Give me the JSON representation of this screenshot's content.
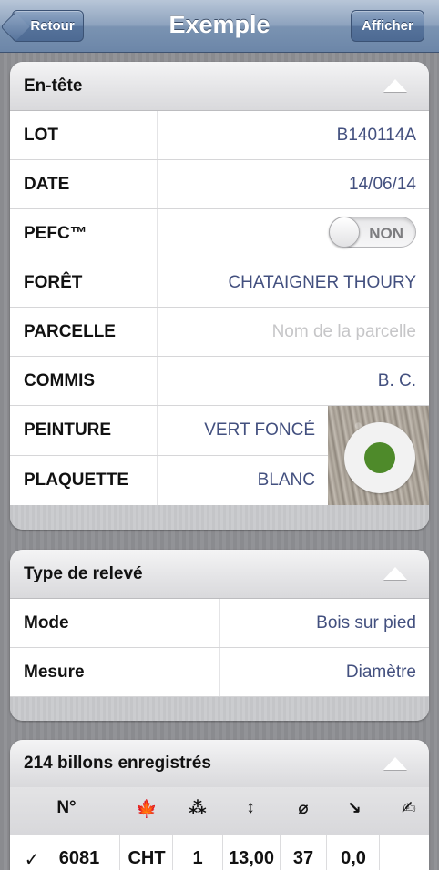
{
  "nav": {
    "title": "Exemple",
    "back_label": "Retour",
    "show_label": "Afficher"
  },
  "header_section": {
    "title": "En-tête",
    "rows": [
      {
        "label": "LOT",
        "value": "B140114A"
      },
      {
        "label": "DATE",
        "value": "14/06/14"
      },
      {
        "label": "PEFC™",
        "toggle": "NON"
      },
      {
        "label": "FORÊT",
        "value": "CHATAIGNER THOURY"
      },
      {
        "label": "PARCELLE",
        "placeholder": "Nom de la parcelle"
      },
      {
        "label": "COMMIS",
        "value": "B. C."
      },
      {
        "label": "PEINTURE",
        "value": "VERT FONCÉ"
      },
      {
        "label": "PLAQUETTE",
        "value": "BLANC"
      }
    ],
    "paint_color": "#4e8a2a"
  },
  "survey_section": {
    "title": "Type de relevé",
    "rows": [
      {
        "label": "Mode",
        "value": "Bois sur pied"
      },
      {
        "label": "Mesure",
        "value": "Diamètre"
      }
    ]
  },
  "logs_section": {
    "title": "214 billons enregistrés",
    "columns": [
      {
        "label": "N°"
      },
      {
        "icon": "maple-leaf-icon",
        "glyph": "🍁"
      },
      {
        "icon": "stars-icon",
        "glyph": "⁂"
      },
      {
        "icon": "length-icon",
        "glyph": "↕"
      },
      {
        "icon": "diameter-icon",
        "glyph": "⌀"
      },
      {
        "icon": "arrow-down-right-icon",
        "glyph": "↘"
      },
      {
        "icon": "edit-icon",
        "glyph": "✍"
      }
    ],
    "rows": [
      {
        "check": "✓",
        "number": "6081",
        "species": "CHT",
        "quality": "1",
        "length": "13,00",
        "diameter": "37",
        "volume": "0,0",
        "note": ""
      }
    ]
  }
}
